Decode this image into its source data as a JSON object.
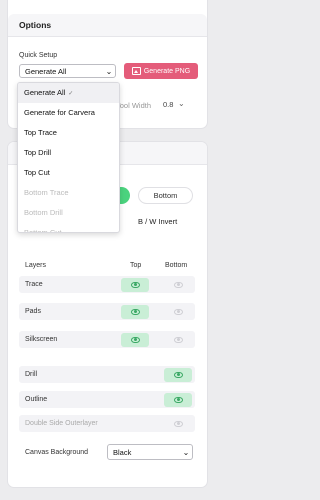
{
  "options": {
    "title": "Options",
    "quick_setup_label": "Quick Setup",
    "quick_setup_value": "Generate All",
    "generate_png_label": "Generate PNG",
    "tool_width_label": "Tool Width",
    "tool_width_value": "0.8",
    "dropdown_items": [
      {
        "label": "Generate All",
        "selected": true,
        "disabled": false
      },
      {
        "label": "Generate for Carvera",
        "selected": false,
        "disabled": false
      },
      {
        "label": "Top Trace",
        "selected": false,
        "disabled": false
      },
      {
        "label": "Top Drill",
        "selected": false,
        "disabled": false
      },
      {
        "label": "Top Cut",
        "selected": false,
        "disabled": false
      },
      {
        "label": "Bottom Trace",
        "selected": false,
        "disabled": true
      },
      {
        "label": "Bottom Drill",
        "selected": false,
        "disabled": true
      },
      {
        "label": "Bottom Cut",
        "selected": false,
        "disabled": true
      }
    ]
  },
  "view": {
    "side_bottom_label": "Bottom",
    "bw_invert_label": "B / W Invert",
    "layers_header": "Layers",
    "top_header": "Top",
    "bottom_header": "Bottom",
    "layers": [
      {
        "name": "Trace",
        "top": true,
        "bottom": false
      },
      {
        "name": "Pads",
        "top": true,
        "bottom": false
      },
      {
        "name": "Silkscreen",
        "top": true,
        "bottom": false
      }
    ],
    "single_layers": [
      {
        "name": "Drill",
        "on": true
      },
      {
        "name": "Outline",
        "on": true
      },
      {
        "name": "Double Side Outerlayer",
        "on": false
      }
    ],
    "canvas_background_label": "Canvas Background",
    "canvas_background_value": "Black"
  },
  "colors": {
    "accent_pink": "#e45c7a",
    "toggle_green": "#4bd37e",
    "eye_on_bg": "#c9eed6"
  }
}
